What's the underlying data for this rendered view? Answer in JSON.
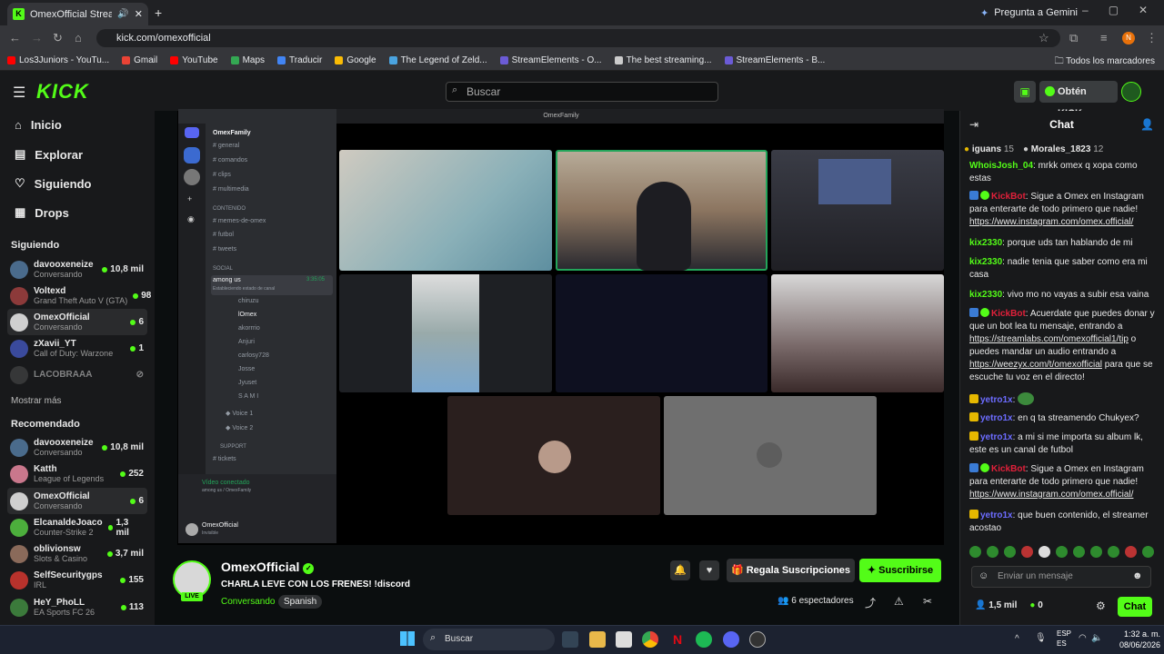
{
  "browser": {
    "tab_title": "OmexOfficial Stream - Wat",
    "gemini": "Pregunta a Gemini",
    "url": "kick.com/omexofficial",
    "bookmarks": [
      {
        "label": "Los3Juniors - YouTu...",
        "color": "#ff0000"
      },
      {
        "label": "Gmail",
        "color": "#ea4335"
      },
      {
        "label": "YouTube",
        "color": "#ff0000"
      },
      {
        "label": "Maps",
        "color": "#34a853"
      },
      {
        "label": "Traducir",
        "color": "#4285f4"
      },
      {
        "label": "Google",
        "color": "#fbbc05"
      },
      {
        "label": "The Legend of Zeld...",
        "color": "#4aa3df"
      },
      {
        "label": "StreamElements - O...",
        "color": "#6b5bd6"
      },
      {
        "label": "The best streaming...",
        "color": "#cccccc"
      },
      {
        "label": "StreamElements - B...",
        "color": "#6b5bd6"
      }
    ],
    "all_bookmarks": "Todos los marcadores"
  },
  "header": {
    "logo": "KICK",
    "search_placeholder": "Buscar",
    "get_kicks": "Obtén KICKs"
  },
  "sidebar": {
    "nav": [
      {
        "label": "Inicio",
        "icon": "home-icon"
      },
      {
        "label": "Explorar",
        "icon": "compass-icon"
      },
      {
        "label": "Siguiendo",
        "icon": "heart-icon"
      },
      {
        "label": "Drops",
        "icon": "drops-icon"
      }
    ],
    "following_title": "Siguiendo",
    "following": [
      {
        "name": "davooxeneize",
        "category": "Conversando",
        "viewers": "10,8 mil",
        "color": "#4a6b8c"
      },
      {
        "name": "Voltexd",
        "category": "Grand Theft Auto V (GTA)",
        "viewers": "98",
        "color": "#8c3a3a"
      },
      {
        "name": "OmexOfficial",
        "category": "Conversando",
        "viewers": "6",
        "color": "#cfcfcf"
      },
      {
        "name": "zXavii_YT",
        "category": "Call of Duty: Warzone",
        "viewers": "1",
        "color": "#3a4a9c"
      },
      {
        "name": "LACOBRAAA",
        "category": "",
        "viewers": "",
        "color": "#555555"
      }
    ],
    "show_more": "Mostrar más",
    "recommended_title": "Recomendado",
    "recommended": [
      {
        "name": "davooxeneize",
        "category": "Conversando",
        "viewers": "10,8 mil",
        "color": "#4a6b8c"
      },
      {
        "name": "Katth",
        "category": "League of Legends",
        "viewers": "252",
        "color": "#c9778c"
      },
      {
        "name": "OmexOfficial",
        "category": "Conversando",
        "viewers": "6",
        "color": "#cfcfcf"
      },
      {
        "name": "ElcanaldeJoaco",
        "category": "Counter-Strike 2",
        "viewers": "1,3 mil",
        "color": "#4cae3c"
      },
      {
        "name": "oblivionsw",
        "category": "Slots & Casino",
        "viewers": "3,7 mil",
        "color": "#8a6a5a"
      },
      {
        "name": "SelfSecuritygps",
        "category": "IRL",
        "viewers": "155",
        "color": "#b8322c"
      },
      {
        "name": "HeY_PhoLL",
        "category": "EA Sports FC 26",
        "viewers": "113",
        "color": "#3b7a3b"
      }
    ]
  },
  "discord": {
    "window_title": "OmexFamily",
    "server": "OmexFamily",
    "channels_top": [
      "general",
      "comandos",
      "clips",
      "multimedia"
    ],
    "cat_content": "CONTENIDO",
    "channels_content": [
      "memes-de-omex",
      "futbol",
      "tweets"
    ],
    "cat_social": "SOCIAL",
    "voice_active": "among us",
    "voice_timer": "3:35:05",
    "voice_sub": "Estableciendo estado de canal",
    "users": [
      "chiruzu",
      "lOmex",
      "akorrrio",
      "Anjuri",
      "carlosy728",
      "Josse",
      "Jyuset",
      "S A M I"
    ],
    "voice_channels": [
      "Voice 1",
      "Voice 2"
    ],
    "cat_support": "SUPPORT",
    "channel_tickets": "tickets",
    "connected": "Vídeo conectado",
    "connected_sub": "among us / OmexFamily",
    "user_name": "OmexOfficial",
    "user_status": "Invisible"
  },
  "stream": {
    "name": "OmexOfficial",
    "title": "CHARLA LEVE CON LOS FRENES! !discord",
    "category": "Conversando",
    "language": "Spanish",
    "live": "LIVE",
    "gift_subs": "Regala Suscripciones",
    "subscribe": "Suscribirse",
    "viewers": "6 espectadores"
  },
  "chat": {
    "title": "Chat",
    "top_gifters": [
      {
        "name": "iguans",
        "count": "15"
      },
      {
        "name": "Morales_1823",
        "count": "12"
      }
    ],
    "messages": [
      {
        "user": "WhoisJosh_04",
        "color": "#53fc18",
        "text": "mrkk omex q xopa como estas"
      },
      {
        "user": "KickBot",
        "color": "#e0203a",
        "text": "Sigue a Omex en Instagram para enterarte de todo primero que nadie!",
        "link": "https://www.instagram.com/omex.official/"
      },
      {
        "user": "kix2330",
        "color": "#53fc18",
        "text": "porque uds tan hablando de mi"
      },
      {
        "user": "kix2330",
        "color": "#53fc18",
        "text": "nadie tenia que saber como era mi casa"
      },
      {
        "user": "kix2330",
        "color": "#53fc18",
        "text": "vivo mo no vayas a subir esa vaina"
      },
      {
        "user": "KickBot",
        "color": "#e0203a",
        "text": "Acuerdate que puedes donar y que un bot lea tu mensaje, entrando a",
        "link": "https://streamlabs.com/omexofficial1/tip",
        "text2": "o puedes mandar un audio entrando a",
        "link2": "https://weezyx.com/t/omexofficial",
        "text3": "para que se escuche tu voz en el directo!"
      },
      {
        "user": "yetro1x",
        "color": "#6c6cff",
        "text": ""
      },
      {
        "user": "yetro1x",
        "color": "#6c6cff",
        "text": "en q ta streamendo Chukyex?"
      },
      {
        "user": "yetro1x",
        "color": "#6c6cff",
        "text": "a mi si me importa su album lk, este es un canal de futbol"
      },
      {
        "user": "KickBot",
        "color": "#e0203a",
        "text": "Sigue a Omex en Instagram para enterarte de todo primero que nadie!",
        "link": "https://www.instagram.com/omex.official/"
      },
      {
        "user": "yetro1x",
        "color": "#6c6cff",
        "text": "que buen contenido, el streamer acostao"
      }
    ],
    "input_placeholder": "Enviar un mensaje",
    "followers": "1,5 mil",
    "kicks": "0",
    "send": "Chat"
  },
  "taskbar": {
    "search": "Buscar",
    "lang1": "ESP",
    "lang2": "ES",
    "time": "1:32 a. m.",
    "date": "08/06/2026"
  }
}
